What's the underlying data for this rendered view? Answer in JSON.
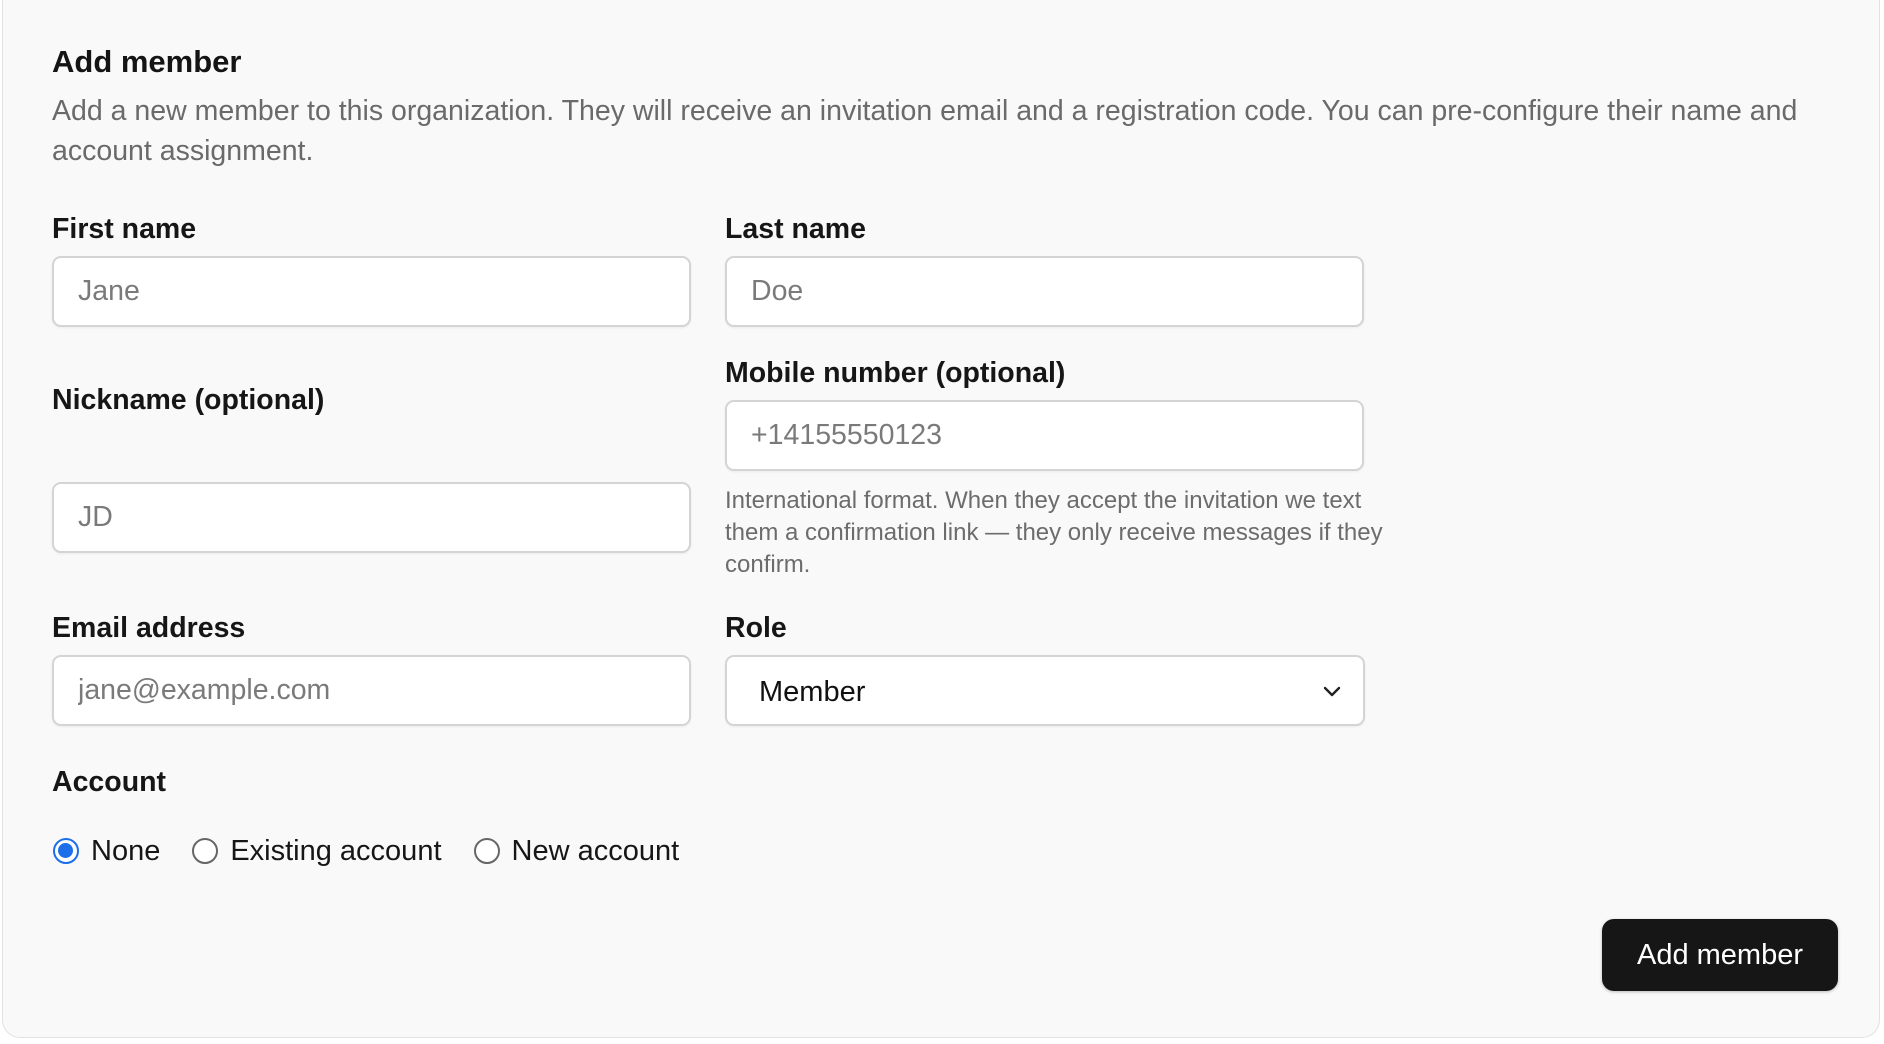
{
  "form": {
    "title": "Add member",
    "description": "Add a new member to this organization. They will receive an invitation email and a registration code. You can pre-configure their name and account assignment.",
    "first_name": {
      "label": "First name",
      "value": "",
      "placeholder": "Jane"
    },
    "last_name": {
      "label": "Last name",
      "value": "",
      "placeholder": "Doe"
    },
    "nickname": {
      "label": "Nickname (optional)",
      "value": "",
      "placeholder": "JD"
    },
    "mobile": {
      "label": "Mobile number (optional)",
      "value": "",
      "placeholder": "+14155550123",
      "help": "International format. When they accept the invitation we text them a confirmation link — they only receive messages if they confirm."
    },
    "email": {
      "label": "Email address",
      "value": "",
      "placeholder": "jane@example.com"
    },
    "role": {
      "label": "Role",
      "selected": "Member",
      "icon": "chevron-down-icon"
    },
    "account": {
      "label": "Account",
      "selected": "None",
      "options": [
        "None",
        "Existing account",
        "New account"
      ]
    },
    "submit_label": "Add member",
    "colors": {
      "accent": "#1c6fe8",
      "button_bg": "#161616",
      "card_bg": "#f9f9f9",
      "muted_text": "#6a6a6a"
    }
  }
}
